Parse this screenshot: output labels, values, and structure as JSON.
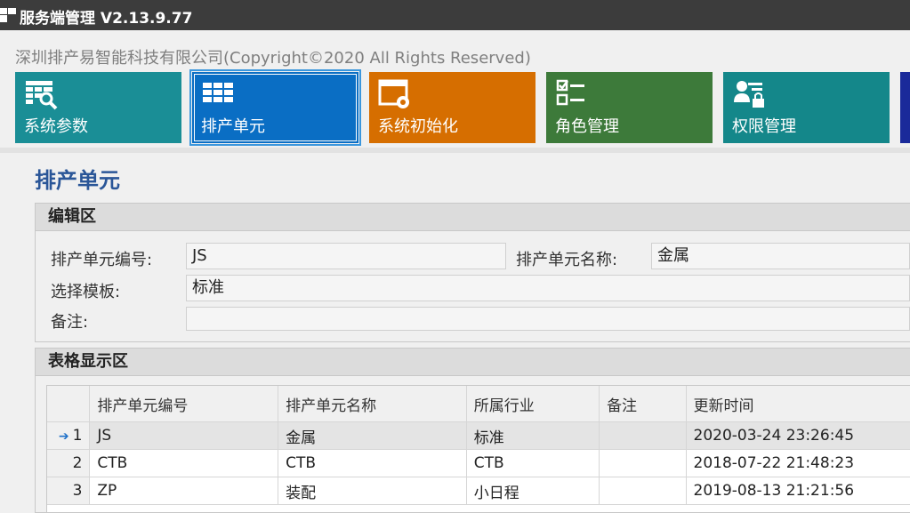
{
  "window": {
    "title": "服务端管理 V2.13.9.77"
  },
  "copyright": "深圳排产易智能科技有限公司(Copyright©2020 All Rights Reserved)",
  "tiles": [
    {
      "label": "系统参数",
      "color": "#1a8e96",
      "icon": "settings-table-icon"
    },
    {
      "label": "排产单元",
      "color": "#0a6ec4",
      "icon": "grid-icon"
    },
    {
      "label": "系统初始化",
      "color": "#d66e00",
      "icon": "window-gear-icon"
    },
    {
      "label": "角色管理",
      "color": "#3d7a3a",
      "icon": "checklist-icon"
    },
    {
      "label": "权限管理",
      "color": "#14878a",
      "icon": "user-lock-icon"
    }
  ],
  "page_title": "排产单元",
  "edit_section": {
    "title": "编辑区",
    "code_label": "排产单元编号:",
    "code_value": "JS",
    "name_label": "排产单元名称:",
    "name_value": "金属",
    "template_label": "选择模板:",
    "template_value": "标准",
    "remark_label": "备注:",
    "remark_value": ""
  },
  "table_section": {
    "title": "表格显示区",
    "columns": [
      "排产单元编号",
      "排产单元名称",
      "所属行业",
      "备注",
      "更新时间"
    ],
    "rows": [
      {
        "n": "1",
        "code": "JS",
        "name": "金属",
        "industry": "标准",
        "remark": "",
        "updated": "2020-03-24 23:26:45"
      },
      {
        "n": "2",
        "code": "CTB",
        "name": "CTB",
        "industry": "CTB",
        "remark": "",
        "updated": "2018-07-22 21:48:23"
      },
      {
        "n": "3",
        "code": "ZP",
        "name": "装配",
        "industry": "小日程",
        "remark": "",
        "updated": "2019-08-13 21:21:56"
      }
    ]
  }
}
